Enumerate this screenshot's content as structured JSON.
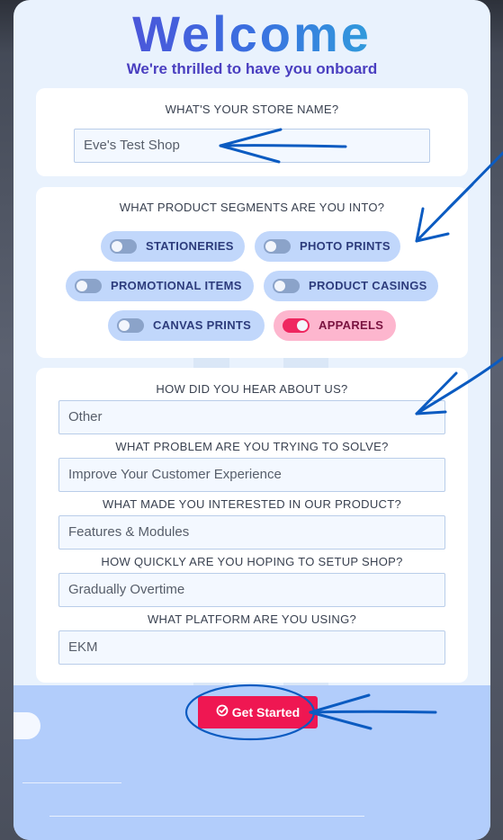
{
  "header": {
    "title": "Welcome",
    "subtitle": "We're thrilled to have you onboard"
  },
  "store": {
    "label": "WHAT'S YOUR STORE NAME?",
    "value": "Eve's Test Shop"
  },
  "segments": {
    "label": "WHAT PRODUCT SEGMENTS ARE YOU INTO?",
    "items": [
      {
        "label": "STATIONERIES",
        "on": false
      },
      {
        "label": "PHOTO PRINTS",
        "on": false
      },
      {
        "label": "PROMOTIONAL ITEMS",
        "on": false
      },
      {
        "label": "PRODUCT CASINGS",
        "on": false
      },
      {
        "label": "CANVAS PRINTS",
        "on": false
      },
      {
        "label": "APPARELS",
        "on": true
      }
    ]
  },
  "survey": {
    "questions": [
      {
        "label": "HOW DID YOU HEAR ABOUT US?",
        "value": "Other"
      },
      {
        "label": "WHAT PROBLEM ARE YOU TRYING TO SOLVE?",
        "value": "Improve Your Customer Experience"
      },
      {
        "label": "WHAT MADE YOU INTERESTED IN OUR PRODUCT?",
        "value": "Features & Modules"
      },
      {
        "label": "HOW QUICKLY ARE YOU HOPING TO SETUP SHOP?",
        "value": "Gradually Overtime"
      },
      {
        "label": "WHAT PLATFORM ARE YOU USING?",
        "value": "EKM"
      }
    ]
  },
  "cta": {
    "label": "Get Started",
    "icon": "check-circle-icon"
  },
  "colors": {
    "accent": "#ef1752",
    "toggle_on": "#ef2760",
    "pill": "#c1d7fb",
    "annotation": "#0b5bc1"
  }
}
